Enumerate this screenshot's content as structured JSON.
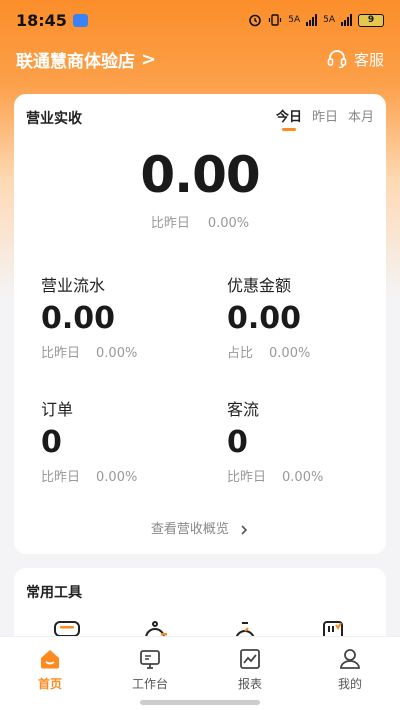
{
  "status_bar": {
    "time": "18:45",
    "network_1": "5A",
    "network_2": "5A",
    "battery": "9"
  },
  "header": {
    "store_name": "联通慧商体验店",
    "chevron": ">",
    "service_label": "客服"
  },
  "revenue": {
    "title": "营业实收",
    "tabs": [
      {
        "label": "今日",
        "active": true
      },
      {
        "label": "昨日",
        "active": false
      },
      {
        "label": "本月",
        "active": false
      }
    ],
    "amount": "0.00",
    "compare_label": "比昨日",
    "compare_value": "0.00%",
    "metrics": [
      {
        "label": "营业流水",
        "value": "0.00",
        "cmp_label": "比昨日",
        "cmp_value": "0.00%"
      },
      {
        "label": "优惠金额",
        "value": "0.00",
        "cmp_label": "占比",
        "cmp_value": "0.00%"
      },
      {
        "label": "订单",
        "value": "0",
        "cmp_label": "比昨日",
        "cmp_value": "0.00%"
      },
      {
        "label": "客流",
        "value": "0",
        "cmp_label": "比昨日",
        "cmp_value": "0.00%"
      }
    ],
    "overview_link": "查看营收概览"
  },
  "tools": {
    "title": "常用工具",
    "icons": [
      "tray-icon",
      "bell-icon",
      "timer-icon",
      "receipt-icon"
    ]
  },
  "tabbar": {
    "items": [
      {
        "label": "首页",
        "icon": "home-icon",
        "active": true
      },
      {
        "label": "工作台",
        "icon": "monitor-icon",
        "active": false
      },
      {
        "label": "报表",
        "icon": "chart-icon",
        "active": false
      },
      {
        "label": "我的",
        "icon": "user-icon",
        "active": false
      }
    ]
  },
  "colors": {
    "accent": "#ff8a1f",
    "header_bg": "#fb8e2a"
  }
}
